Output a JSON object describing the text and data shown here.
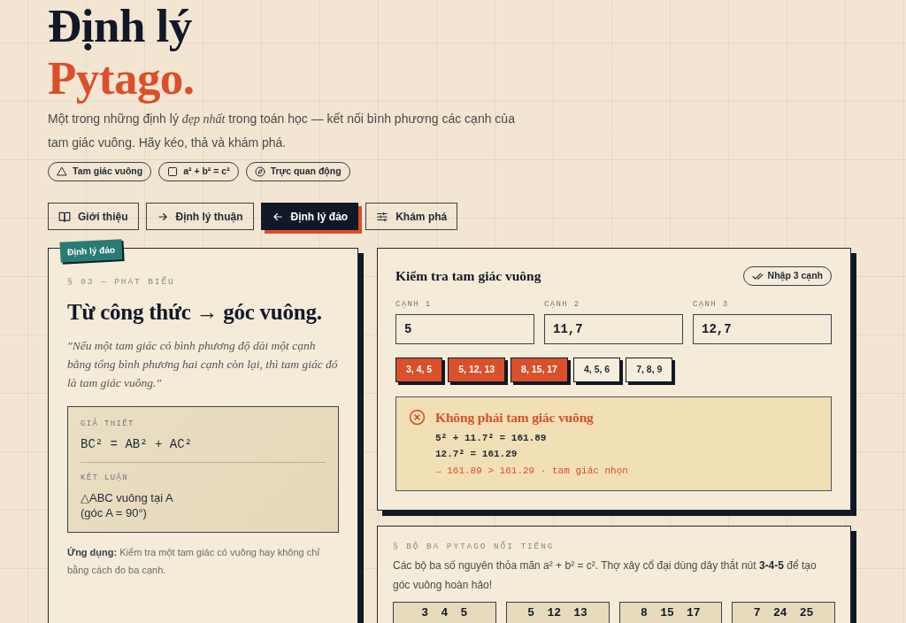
{
  "hero": {
    "title_line_1": "Định lý",
    "title_line_2": "Pytago.",
    "intro": "Một trong những định lý *đẹp nhất* trong toán học — kết nối bình phương các cạnh của tam giác vuông. Hãy kéo, thả và khám phá.",
    "chips": [
      {
        "label": "Tam giác vuông"
      },
      {
        "label": "a² + b² = c²"
      },
      {
        "label": "Trực quan động"
      }
    ]
  },
  "nav": {
    "tabs": [
      {
        "label": "Giới thiệu",
        "selected": false
      },
      {
        "label": "Định lý thuận",
        "selected": false
      },
      {
        "label": "Định lý đảo",
        "selected": true
      },
      {
        "label": "Khám phá",
        "selected": false
      }
    ]
  },
  "statement": {
    "tag": "Định lý đảo",
    "eyebrow": "§ 03 — PHÁT BIỂU",
    "heading": "Từ công thức → góc vuông.",
    "quote": "\"Nếu một tam giác có bình phương độ dài một cạnh bằng tổng bình phương hai cạnh còn lại, thì tam giác đó là tam giác vuông.\"",
    "hypothesis_label": "GIẢ THIẾT",
    "hypothesis": "BC² = AB² + AC²",
    "conclusion_label": "KẾT LUẬN",
    "conclusion_lines": [
      "△ABC vuông tại A",
      "(góc A = 90°)"
    ],
    "note": "**Ứng dụng:** Kiểm tra một tam giác có vuông hay không chỉ bằng cách đo ba cạnh."
  },
  "checker": {
    "title": "Kiểm tra tam giác vuông",
    "badge": "Nhập 3 cạnh",
    "sides": [
      {
        "label": "CẠNH 1",
        "value": "5"
      },
      {
        "label": "CẠNH 2",
        "value": "11,7"
      },
      {
        "label": "CẠNH 3",
        "value": "12,7"
      }
    ],
    "presets": [
      {
        "label": "3, 4, 5",
        "right_triangle": true
      },
      {
        "label": "5, 12, 13",
        "right_triangle": true
      },
      {
        "label": "8, 15, 17",
        "right_triangle": true
      },
      {
        "label": "4, 5, 6",
        "right_triangle": false
      },
      {
        "label": "7, 8, 9",
        "right_triangle": false
      }
    ],
    "result": {
      "kind": "not_right",
      "title": "Không phải tam giác vuông",
      "lines": [
        {
          "kind": "work",
          "text": "5² + 11.7² = 161.89"
        },
        {
          "kind": "work",
          "text": "12.7² = 161.29"
        },
        {
          "kind": "verdict",
          "text": "→ 161.89 > 161.29 · tam giác nhọn"
        }
      ]
    }
  },
  "triples": {
    "eyebrow": "§ BỘ BA PYTAGO NỔI TIẾNG",
    "text": "Các bộ ba số nguyên thỏa mãn a² + b² = c². Thợ xây cổ đại dùng dây thắt nút **3-4-5** để tạo góc vuông hoàn hảo!",
    "items": [
      "3 4 5",
      "5 12 13",
      "8 15 17",
      "7 24 25"
    ]
  }
}
